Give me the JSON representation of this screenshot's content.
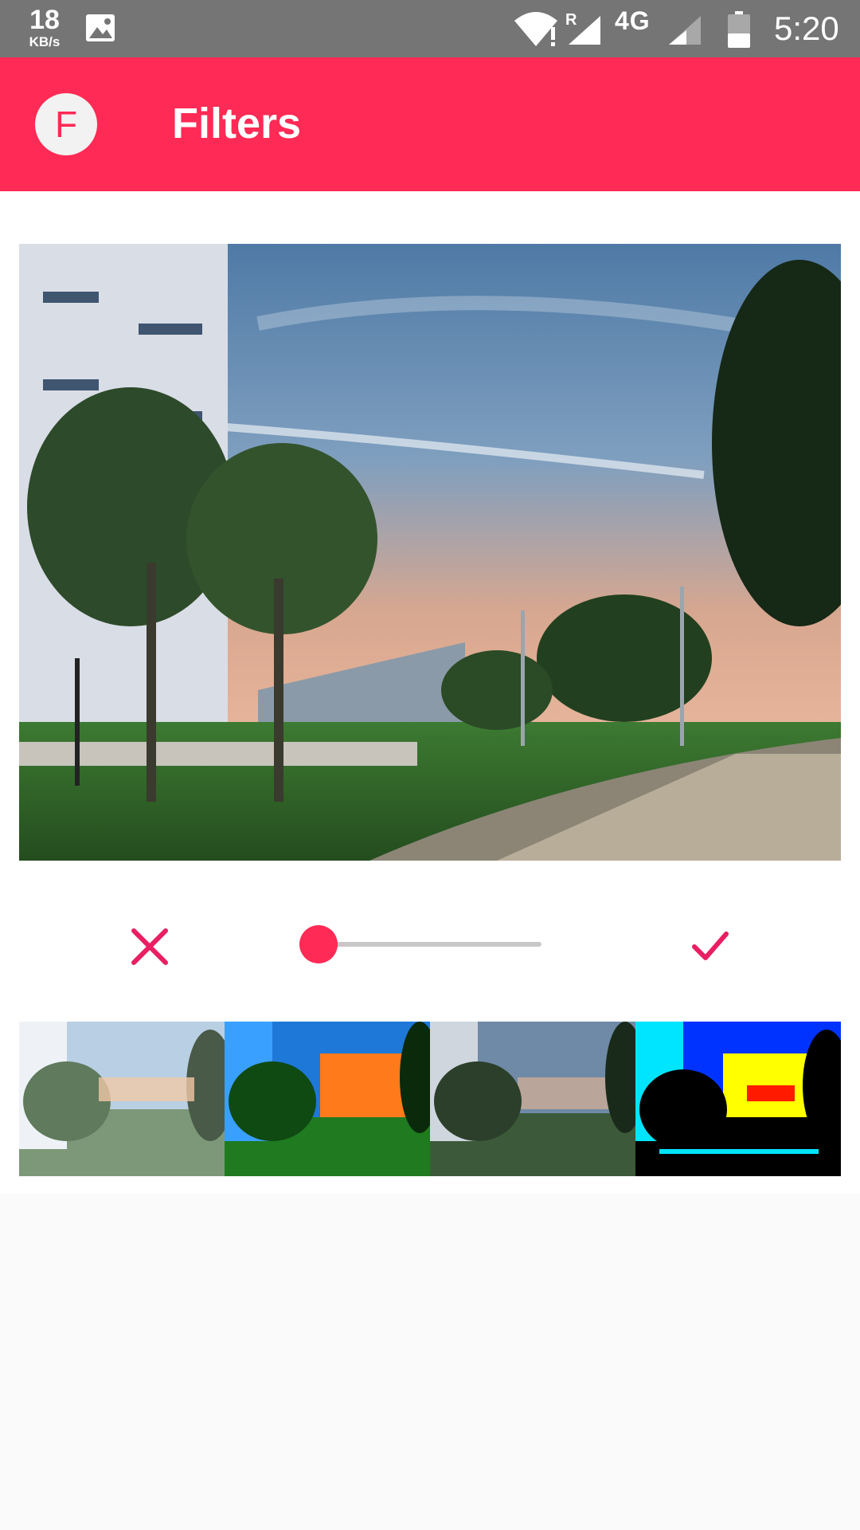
{
  "status_bar": {
    "speed_value": "18",
    "speed_unit": "KB/s",
    "roaming": "R",
    "network": "4G",
    "time": "5:20"
  },
  "app_bar": {
    "avatar_letter": "F",
    "title": "Filters"
  },
  "editor": {
    "intensity_fraction": 0.0
  },
  "filters": [
    {
      "id": "filter-1",
      "style": "faded"
    },
    {
      "id": "filter-2",
      "style": "vivid"
    },
    {
      "id": "filter-3",
      "style": "cool"
    },
    {
      "id": "filter-4",
      "style": "posterize"
    }
  ],
  "colors": {
    "accent": "#ff2a55",
    "status_bar": "#757575",
    "background": "#fafafa",
    "icon_tint": "#e91e63"
  }
}
